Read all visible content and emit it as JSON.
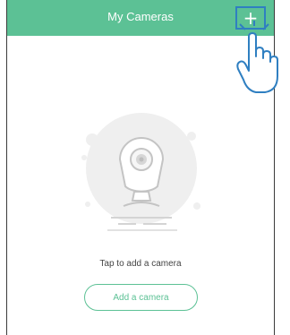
{
  "header": {
    "title": "My Cameras",
    "add_symbol": "+"
  },
  "empty_state": {
    "illustration_icon": "camera-icon",
    "message": "Tap to add a camera",
    "button_label": "Add a camera"
  },
  "overlay": {
    "pointer_icon": "tap-hand-icon"
  },
  "colors": {
    "header_bg": "#5cc195",
    "accent": "#5cc195",
    "highlight": "#2f7fc1"
  }
}
